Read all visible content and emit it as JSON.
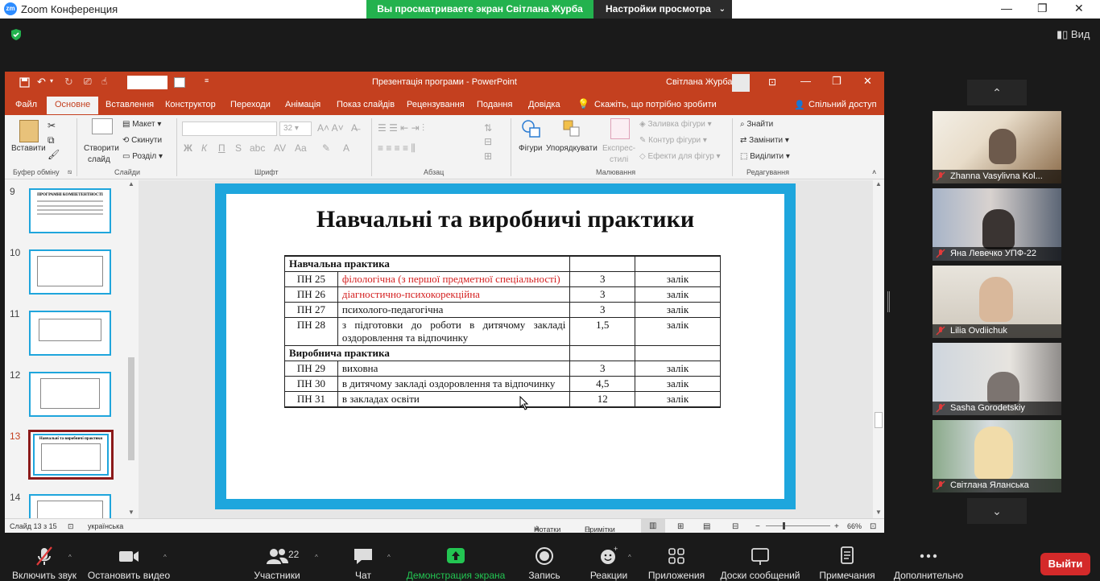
{
  "zoom": {
    "window_title": "Zoom Конференция",
    "share_banner": "Вы просматриваете экран Світлана Журба",
    "view_settings": "Настройки просмотра",
    "view_button": "Вид",
    "leave": "Выйти"
  },
  "ppt": {
    "title": "Презентація програми  -  PowerPoint",
    "user": "Світлана Журба",
    "tabs": [
      "Файл",
      "Основне",
      "Вставлення",
      "Конструктор",
      "Переходи",
      "Анімація",
      "Показ слайдів",
      "Рецензування",
      "Подання",
      "Довідка"
    ],
    "tell_me": "Скажіть, що потрібно зробити",
    "share": "Спільний доступ",
    "ribbon": {
      "paste": "Вставити",
      "new_slide_1": "Створити",
      "new_slide_2": "слайд",
      "layout": "Макет",
      "reset": "Скинути",
      "section": "Розділ",
      "font_size": "32",
      "shapes": "Фігури",
      "arrange": "Упорядкувати",
      "quick_styles_1": "Експрес-",
      "quick_styles_2": "стилі",
      "shape_fill": "Заливка фігури",
      "shape_outline": "Контур фігури",
      "shape_effects": "Ефекти для фігур",
      "find": "Знайти",
      "replace": "Замінити",
      "select": "Виділити",
      "groups": {
        "clipboard": "Буфер обміну",
        "slides": "Слайди",
        "font": "Шрифт",
        "paragraph": "Абзац",
        "drawing": "Малювання",
        "editing": "Редагування"
      },
      "font_buttons": [
        "Ж",
        "К",
        "П",
        "S"
      ]
    },
    "thumbs": [
      {
        "num": "9",
        "heading": "ПРОГРАМНІ КОМПЕТЕНТНОСТІ"
      },
      {
        "num": "10"
      },
      {
        "num": "11"
      },
      {
        "num": "12"
      },
      {
        "num": "13",
        "heading": "Навчальні та виробничі практики"
      },
      {
        "num": "14"
      }
    ],
    "slide": {
      "title": "Навчальні та виробничі практики",
      "section1": "Навчальна практика",
      "section2": "Виробнича практика",
      "rows1": [
        {
          "code": "ПН 25",
          "name": "філологічна (з першої предметної спеціальності)",
          "credits": "3",
          "control": "залік",
          "red": true
        },
        {
          "code": "ПН 26",
          "name": "діагностично-психокорекційна",
          "credits": "3",
          "control": "залік",
          "red": true
        },
        {
          "code": "ПН 27",
          "name": "психолого-педагогічна",
          "credits": "3",
          "control": "залік",
          "red": false
        },
        {
          "code": "ПН 28",
          "name": "з підготовки до роботи в дитячому закладі оздоровлення та відпочинку",
          "credits": "1,5",
          "control": "залік",
          "red": false
        }
      ],
      "rows2": [
        {
          "code": "ПН 29",
          "name": "виховна",
          "credits": "3",
          "control": "залік",
          "red": false
        },
        {
          "code": "ПН 30",
          "name": "в дитячому закладі оздоровлення та відпочинку",
          "credits": "4,5",
          "control": "залік",
          "red": false
        },
        {
          "code": "ПН 31",
          "name": "в закладах освіти",
          "credits": "12",
          "control": "залік",
          "red": false
        }
      ]
    },
    "status": {
      "slide": "Слайд 13 з 15",
      "lang": "українська",
      "notes": "Нотатки",
      "comments": "Примітки",
      "zoom": "66%"
    }
  },
  "participants": [
    {
      "name": "Zhanna Vasylivna Kol..."
    },
    {
      "name": "Яна Левечко УПФ-22"
    },
    {
      "name": "Lilia Ovdiichuk"
    },
    {
      "name": "Sasha Gorodetskiy"
    },
    {
      "name": "Світлана Яланська"
    }
  ],
  "toolbar": {
    "mute": "Включить звук",
    "video": "Остановить видео",
    "participants": "Участники",
    "participants_count": "22",
    "chat": "Чат",
    "share": "Демонстрация экрана",
    "record": "Запись",
    "reactions": "Реакции",
    "apps": "Приложения",
    "whiteboard": "Доски сообщений",
    "notes": "Примечания",
    "more": "Дополнительно"
  },
  "colors": {
    "accent": "#c4401f",
    "share_green": "#23b24e",
    "slide_border": "#1ea6dd",
    "leave_red": "#d42a2a"
  }
}
